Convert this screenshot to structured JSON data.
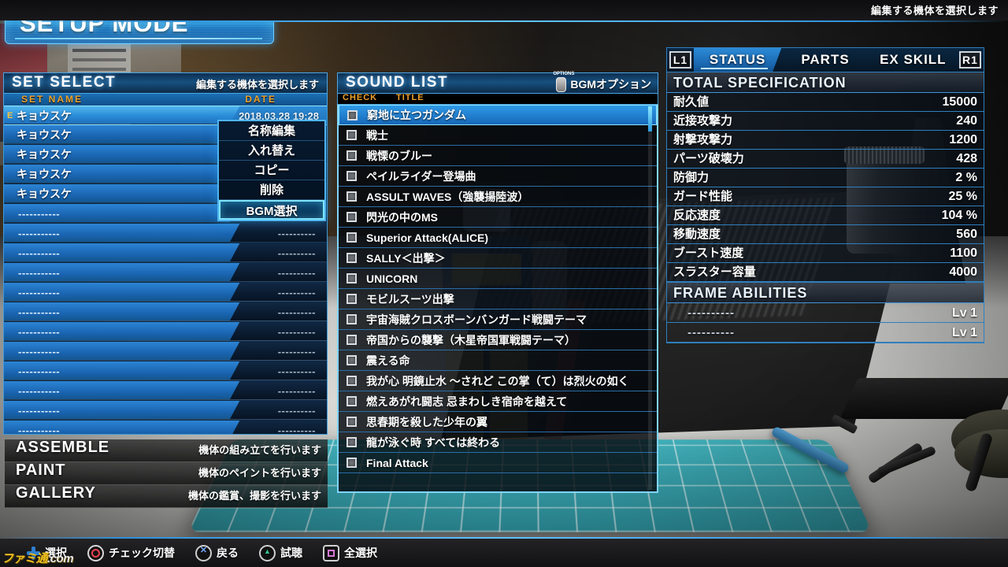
{
  "header": {
    "mode_title": "SETUP MODE",
    "top_hint": "編集する機体を選択します"
  },
  "set_select": {
    "title": "SET SELECT",
    "hint": "編集する機体を選択します",
    "col_name": "SET NAME",
    "col_date": "DATE",
    "rows": [
      {
        "flag": "E",
        "name": "キョウスケ",
        "date": "2018.03.28 19:28",
        "selected": true,
        "empty": false
      },
      {
        "flag": "",
        "name": "キョウスケ",
        "date": "",
        "selected": false,
        "empty": false
      },
      {
        "flag": "",
        "name": "キョウスケ",
        "date": "",
        "selected": false,
        "empty": false
      },
      {
        "flag": "",
        "name": "キョウスケ",
        "date": "",
        "selected": false,
        "empty": false
      },
      {
        "flag": "",
        "name": "キョウスケ",
        "date": "",
        "selected": false,
        "empty": false
      },
      {
        "flag": "",
        "name": "-----------",
        "date": "",
        "selected": false,
        "empty": true
      },
      {
        "flag": "",
        "name": "-----------",
        "date": "----------",
        "selected": false,
        "empty": true
      },
      {
        "flag": "",
        "name": "-----------",
        "date": "----------",
        "selected": false,
        "empty": true
      },
      {
        "flag": "",
        "name": "-----------",
        "date": "----------",
        "selected": false,
        "empty": true
      },
      {
        "flag": "",
        "name": "-----------",
        "date": "----------",
        "selected": false,
        "empty": true
      },
      {
        "flag": "",
        "name": "-----------",
        "date": "----------",
        "selected": false,
        "empty": true
      },
      {
        "flag": "",
        "name": "-----------",
        "date": "----------",
        "selected": false,
        "empty": true
      },
      {
        "flag": "",
        "name": "-----------",
        "date": "----------",
        "selected": false,
        "empty": true
      },
      {
        "flag": "",
        "name": "-----------",
        "date": "----------",
        "selected": false,
        "empty": true
      },
      {
        "flag": "",
        "name": "-----------",
        "date": "----------",
        "selected": false,
        "empty": true
      },
      {
        "flag": "",
        "name": "-----------",
        "date": "----------",
        "selected": false,
        "empty": true
      },
      {
        "flag": "",
        "name": "-----------",
        "date": "----------",
        "selected": false,
        "empty": true
      }
    ]
  },
  "context_menu": {
    "items": [
      {
        "label": "名称編集",
        "selected": false
      },
      {
        "label": "入れ替え",
        "selected": false
      },
      {
        "label": "コピー",
        "selected": false
      },
      {
        "label": "削除",
        "selected": false
      },
      {
        "label": "BGM選択",
        "selected": true
      }
    ]
  },
  "sound_list": {
    "title": "SOUND LIST",
    "options_icon_label": "OPTIONS",
    "options_label": "BGMオプション",
    "col_check": "CHECK",
    "col_title": "TITLE",
    "rows": [
      {
        "title": "窮地に立つガンダム",
        "checked": false,
        "selected": true
      },
      {
        "title": "戦士",
        "checked": false,
        "selected": false
      },
      {
        "title": "戦慄のブルー",
        "checked": false,
        "selected": false
      },
      {
        "title": "ペイルライダー登場曲",
        "checked": false,
        "selected": false
      },
      {
        "title": "ASSULT WAVES（強襲揚陸波）",
        "checked": false,
        "selected": false
      },
      {
        "title": "閃光の中のMS",
        "checked": false,
        "selected": false
      },
      {
        "title": "Superior Attack(ALICE)",
        "checked": false,
        "selected": false
      },
      {
        "title": "SALLY＜出撃＞",
        "checked": false,
        "selected": false
      },
      {
        "title": "UNICORN",
        "checked": false,
        "selected": false
      },
      {
        "title": "モビルスーツ出撃",
        "checked": false,
        "selected": false
      },
      {
        "title": "宇宙海賊クロスボーンバンガード戦闘テーマ",
        "checked": false,
        "selected": false
      },
      {
        "title": "帝国からの襲撃（木星帝国軍戦闘テーマ）",
        "checked": false,
        "selected": false
      },
      {
        "title": "震える命",
        "checked": false,
        "selected": false
      },
      {
        "title": "我が心 明鏡止水 ～されど この掌（て）は烈火の如く",
        "checked": false,
        "selected": false
      },
      {
        "title": "燃えあがれ闘志 忌まわしき宿命を越えて",
        "checked": false,
        "selected": false
      },
      {
        "title": "思春期を殺した少年の翼",
        "checked": false,
        "selected": false
      },
      {
        "title": "龍が泳ぐ時 すべては終わる",
        "checked": false,
        "selected": false
      },
      {
        "title": "Final Attack",
        "checked": false,
        "selected": false
      }
    ]
  },
  "status_panel": {
    "tab_left_bumper": "L1",
    "tab_right_bumper": "R1",
    "tabs": [
      {
        "label": "STATUS",
        "active": true
      },
      {
        "label": "PARTS",
        "active": false
      },
      {
        "label": "EX SKILL",
        "active": false
      }
    ],
    "total_spec_title": "TOTAL SPECIFICATION",
    "specs": [
      {
        "key": "耐久値",
        "value": "15000"
      },
      {
        "key": "近接攻撃力",
        "value": "240"
      },
      {
        "key": "射撃攻撃力",
        "value": "1200"
      },
      {
        "key": "パーツ破壊力",
        "value": "428"
      },
      {
        "key": "防御力",
        "value": "2 %"
      },
      {
        "key": "ガード性能",
        "value": "25 %"
      },
      {
        "key": "反応速度",
        "value": "104 %"
      },
      {
        "key": "移動速度",
        "value": "560"
      },
      {
        "key": "ブースト速度",
        "value": "1100"
      },
      {
        "key": "スラスター容量",
        "value": "4000"
      }
    ],
    "frame_abilities_title": "FRAME ABILITIES",
    "frame_abilities": [
      {
        "key": "----------",
        "value": "Lv 1"
      },
      {
        "key": "----------",
        "value": "Lv 1"
      }
    ]
  },
  "mode_list": [
    {
      "label": "ASSEMBLE",
      "desc": "機体の組み立てを行います"
    },
    {
      "label": "PAINT",
      "desc": "機体のペイントを行います"
    },
    {
      "label": "GALLERY",
      "desc": "機体の鑑賞、撮影を行います"
    }
  ],
  "bottom_bar": {
    "hints": [
      {
        "icon": "dpad-icon",
        "label": "選択"
      },
      {
        "icon": "circle-icon",
        "label": "チェック切替"
      },
      {
        "icon": "cross-icon",
        "label": "戻る"
      },
      {
        "icon": "triangle-icon",
        "label": "試聴"
      },
      {
        "icon": "square-icon",
        "label": "全選択"
      }
    ],
    "watermark_1": "ファミ通",
    "watermark_2": ".com"
  },
  "colors": {
    "accent_cyan": "#7fd4ff",
    "accent_blue": "#2f8ed8",
    "header_orange": "#f0a22a"
  }
}
